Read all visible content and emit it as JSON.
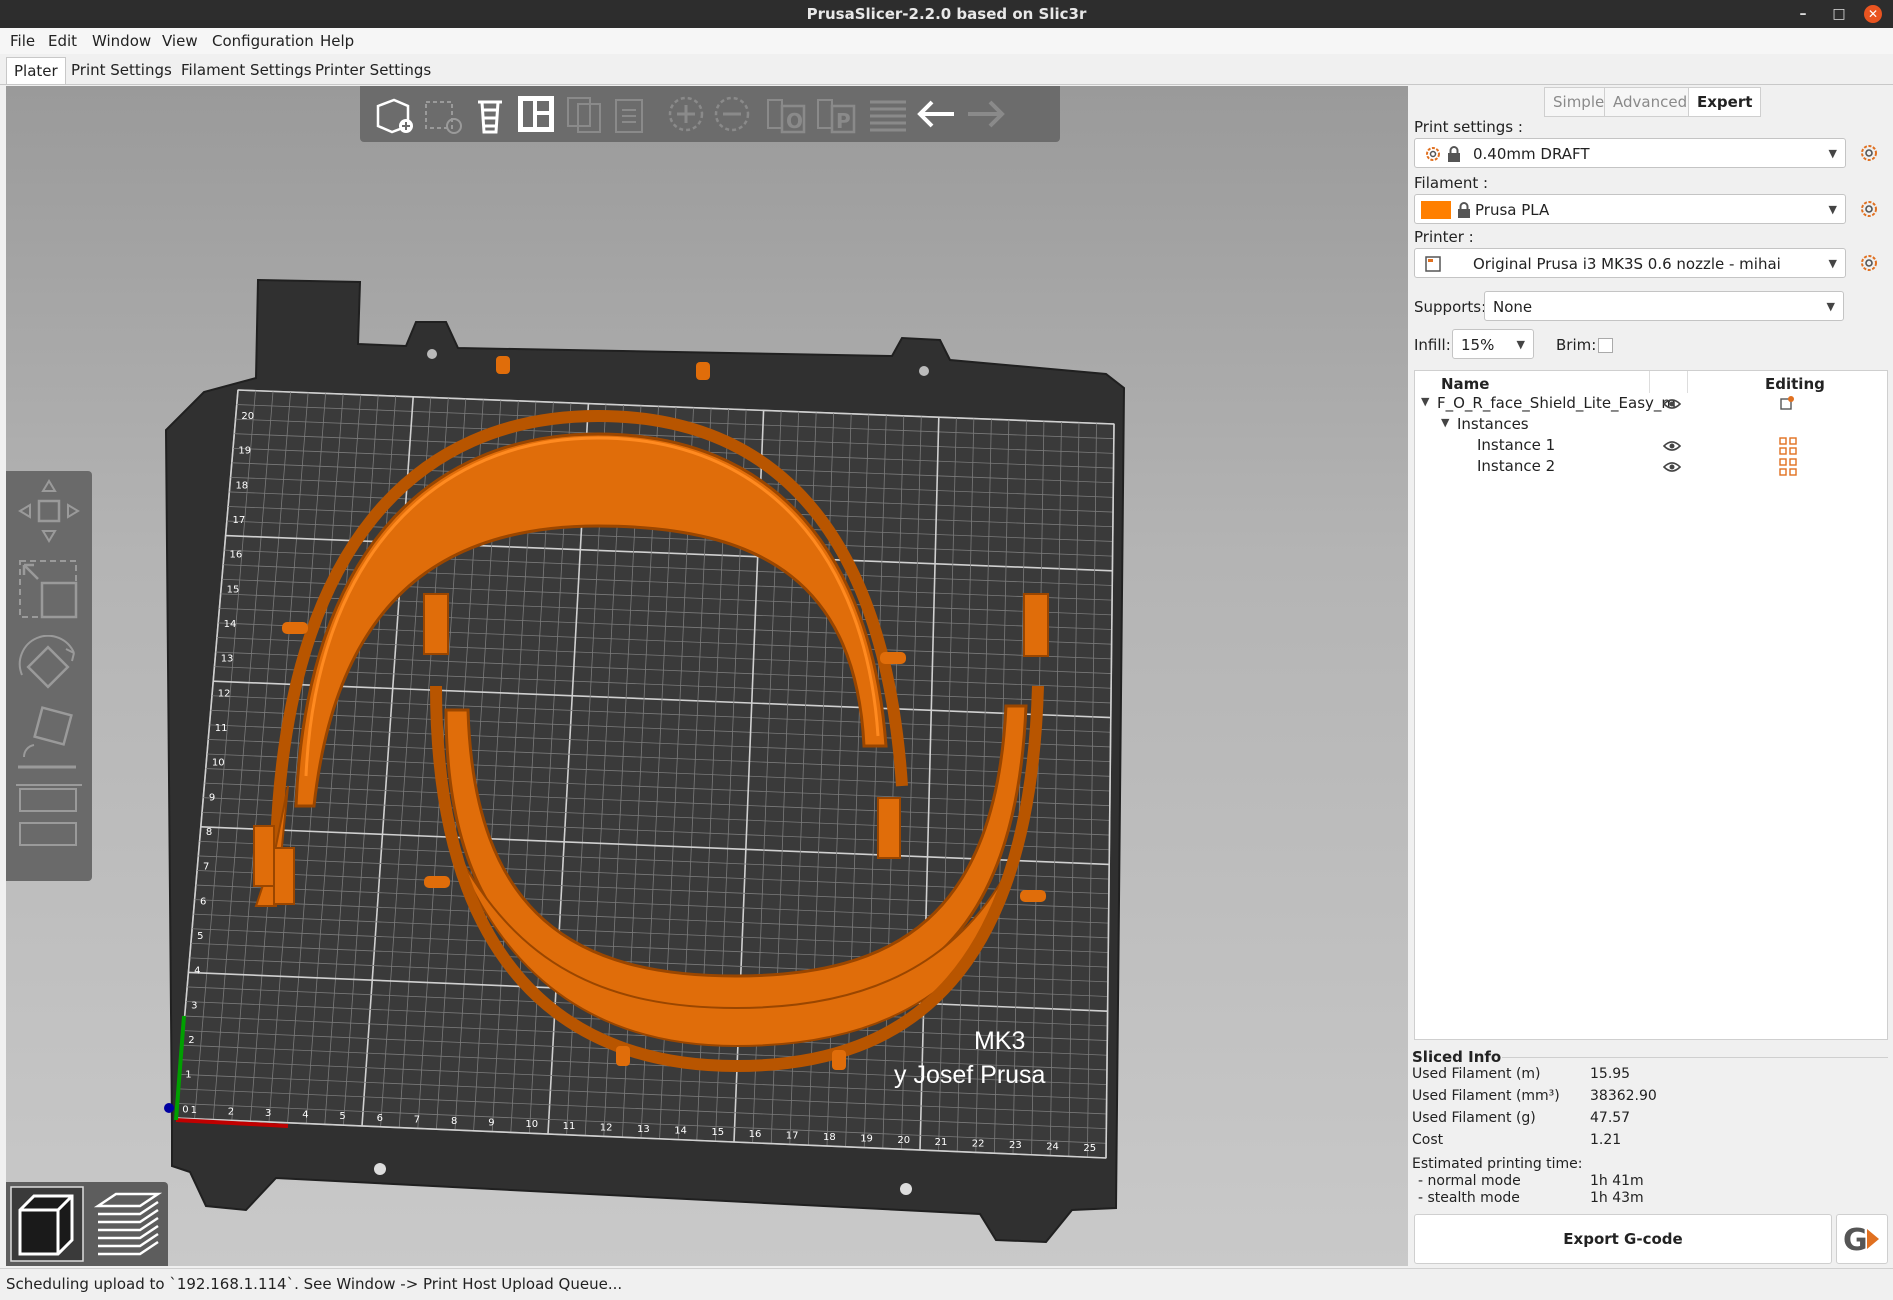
{
  "window": {
    "title": "PrusaSlicer-2.2.0 based on Slic3r"
  },
  "menu": {
    "items": [
      "File",
      "Edit",
      "Window",
      "View",
      "Configuration",
      "Help"
    ]
  },
  "tabs": [
    "Plater",
    "Print Settings",
    "Filament Settings",
    "Printer Settings"
  ],
  "mode": {
    "simple": "Simple",
    "advanced": "Advanced",
    "expert": "Expert",
    "active": "Expert"
  },
  "sidebar": {
    "print_settings_label": "Print settings :",
    "print_settings_value": "0.40mm DRAFT",
    "filament_label": "Filament :",
    "filament_value": "Prusa PLA",
    "filament_color": "#ff7f00",
    "printer_label": "Printer :",
    "printer_value": "Original Prusa i3 MK3S 0.6 nozzle - mihai",
    "supports_label": "Supports:",
    "supports_value": "None",
    "infill_label": "Infill:",
    "infill_value": "15%",
    "brim_label": "Brim:",
    "brim_checked": false
  },
  "object_list": {
    "col_name": "Name",
    "col_editing": "Editing",
    "object_name": "F_O_R_face_Shield_Lite_Easy_m",
    "instances_label": "Instances",
    "instances": [
      "Instance 1",
      "Instance 2"
    ]
  },
  "sliced_info": {
    "title": "Sliced Info",
    "rows": [
      {
        "label": "Used Filament (m)",
        "value": "15.95"
      },
      {
        "label": "Used Filament (mm³)",
        "value": "38362.90"
      },
      {
        "label": "Used Filament (g)",
        "value": "47.57"
      },
      {
        "label": "Cost",
        "value": "1.21"
      }
    ],
    "est_label": "Estimated printing time:",
    "normal_label": "- normal mode",
    "normal_value": "1h 41m",
    "stealth_label": "- stealth mode",
    "stealth_value": "1h 43m"
  },
  "export_label": "Export G-code",
  "bed": {
    "brand_line1": "MK3",
    "brand_line2": "y Josef Prusa",
    "x_ticks": [
      "1",
      "2",
      "3",
      "4",
      "5",
      "6",
      "7",
      "8",
      "9",
      "10",
      "11",
      "12",
      "13",
      "14",
      "15",
      "16",
      "17",
      "18",
      "19",
      "20",
      "21",
      "22",
      "23",
      "24",
      "25"
    ],
    "y_ticks": [
      "0",
      "1",
      "2",
      "3",
      "4",
      "5",
      "6",
      "7",
      "8",
      "9",
      "10",
      "11",
      "12",
      "13",
      "14",
      "15",
      "16",
      "17",
      "18",
      "19",
      "20"
    ],
    "model_color": "#e06d0a"
  },
  "status": "Scheduling upload to `192.168.1.114`. See Window -> Print Host Upload Queue..."
}
